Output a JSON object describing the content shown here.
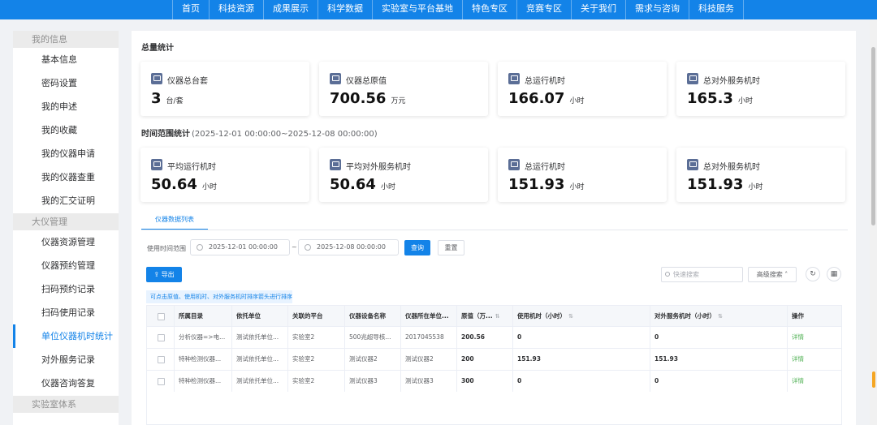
{
  "nav": [
    "首页",
    "科技资源",
    "成果展示",
    "科学数据",
    "实验室与平台基地",
    "特色专区",
    "竞赛专区",
    "关于我们",
    "需求与咨询",
    "科技服务"
  ],
  "sidebar": {
    "group1": "我的信息",
    "items1": [
      "基本信息",
      "密码设置",
      "我的申述",
      "我的收藏",
      "我的仪器申请",
      "我的仪器查重",
      "我的汇交证明"
    ],
    "group2": "大仪管理",
    "items2": [
      "仪器资源管理",
      "仪器预约管理",
      "扫码预约记录",
      "扫码使用记录",
      "单位仪器机时统计",
      "对外服务记录",
      "仪器咨询答复"
    ],
    "group3": "实验室体系",
    "active": "单位仪器机时统计"
  },
  "summary": {
    "title": "总量统计",
    "cards": [
      {
        "label": "仪器总台套",
        "value": "3",
        "unit": "台/套"
      },
      {
        "label": "仪器总原值",
        "value": "700.56",
        "unit": "万元"
      },
      {
        "label": "总运行机时",
        "value": "166.07",
        "unit": "小时"
      },
      {
        "label": "总对外服务机时",
        "value": "165.3",
        "unit": "小时"
      }
    ]
  },
  "range": {
    "title": "时间范围统计",
    "range_text": "(2025-12-01 00:00:00~2025-12-08 00:00:00)",
    "cards": [
      {
        "label": "平均运行机时",
        "value": "50.64",
        "unit": "小时"
      },
      {
        "label": "平均对外服务机时",
        "value": "50.64",
        "unit": "小时"
      },
      {
        "label": "总运行机时",
        "value": "151.93",
        "unit": "小时"
      },
      {
        "label": "总对外服务机时",
        "value": "151.93",
        "unit": "小时"
      }
    ]
  },
  "tab": "仪器数据列表",
  "filter": {
    "label": "使用时间范围",
    "start": "2025-12-01 00:00:00",
    "sep": "~",
    "end": "2025-12-08 00:00:00",
    "query": "查询",
    "reset": "重置"
  },
  "toolbar": {
    "export": "导出",
    "search_placeholder": "快速搜索",
    "advanced": "高级搜索",
    "tip": "可点击原值、使用机时、对外服务机时排序箭头进行排序"
  },
  "table": {
    "headers": [
      "",
      "所属目录",
      "依托单位",
      "关联的平台",
      "仪器设备名称",
      "仪器所在单位...",
      "原值（万...",
      "使用机时（小时）",
      "对外服务机时（小时）",
      "操作"
    ],
    "rows": [
      [
        "",
        "分析仪器=>电...",
        "测试依托单位...",
        "实验室2",
        "500兆超导核...",
        "2017045538",
        "200.56",
        "0",
        "0",
        "详情"
      ],
      [
        "",
        "特种检测仪器...",
        "测试依托单位...",
        "实验室2",
        "测试仪器2",
        "测试仪器2",
        "200",
        "151.93",
        "151.93",
        "详情"
      ],
      [
        "",
        "特种检测仪器...",
        "测试依托单位...",
        "实验室2",
        "测试仪器3",
        "测试仪器3",
        "300",
        "0",
        "0",
        "详情"
      ]
    ]
  },
  "colors": {
    "accent": "#1383e8",
    "link": "#4caf50"
  }
}
